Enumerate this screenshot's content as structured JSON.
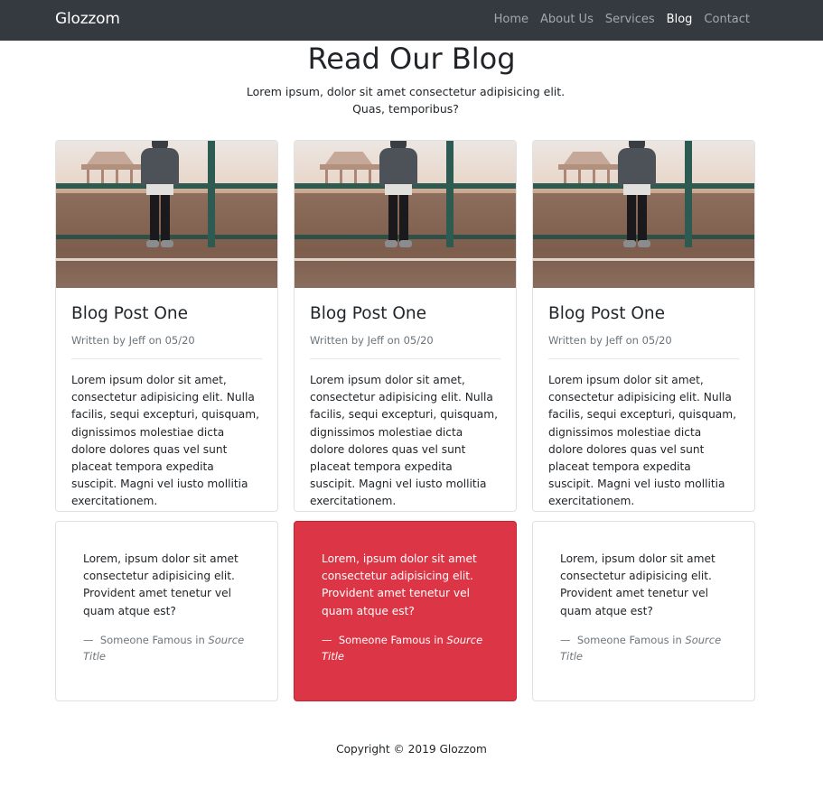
{
  "navbar": {
    "brand": "Glozzom",
    "links": [
      {
        "label": "Home",
        "active": false
      },
      {
        "label": "About Us",
        "active": false
      },
      {
        "label": "Services",
        "active": false
      },
      {
        "label": "Blog",
        "active": true
      },
      {
        "label": "Contact",
        "active": false
      }
    ]
  },
  "header": {
    "title": "Read Our Blog",
    "lead": "Lorem ipsum, dolor sit amet consectetur adipisicing elit. Quas, temporibus?"
  },
  "blog_posts": [
    {
      "title": "Blog Post One",
      "meta": "Written by Jeff on 05/20",
      "text": "Lorem ipsum dolor sit amet, consectetur adipisicing elit. Nulla facilis, sequi excepturi, quisquam, dignissimos molestiae dicta dolore dolores quas vel sunt placeat tempora expedita suscipit. Magni vel iusto mollitia exercitationem."
    },
    {
      "title": "Blog Post One",
      "meta": "Written by Jeff on 05/20",
      "text": "Lorem ipsum dolor sit amet, consectetur adipisicing elit. Nulla facilis, sequi excepturi, quisquam, dignissimos molestiae dicta dolore dolores quas vel sunt placeat tempora expedita suscipit. Magni vel iusto mollitia exercitationem."
    },
    {
      "title": "Blog Post One",
      "meta": "Written by Jeff on 05/20",
      "text": "Lorem ipsum dolor sit amet, consectetur adipisicing elit. Nulla facilis, sequi excepturi, quisquam, dignissimos molestiae dicta dolore dolores quas vel sunt placeat tempora expedita suscipit. Magni vel iusto mollitia exercitationem."
    }
  ],
  "quotes": [
    {
      "text": "Lorem, ipsum dolor sit amet consectetur adipisicing elit. Provident amet tenetur vel quam atque est?",
      "dash": "—",
      "author": "Someone Famous in",
      "source": "Source Title",
      "featured": false
    },
    {
      "text": "Lorem, ipsum dolor sit amet consectetur adipisicing elit. Provident amet tenetur vel quam atque est?",
      "dash": "—",
      "author": "Someone Famous in",
      "source": "Source Title",
      "featured": true
    },
    {
      "text": "Lorem, ipsum dolor sit amet consectetur adipisicing elit. Provident amet tenetur vel quam atque est?",
      "dash": "—",
      "author": "Someone Famous in",
      "source": "Source Title",
      "featured": false
    }
  ],
  "footer": {
    "copyright": "Copyright © 2019 Glozzom"
  },
  "colors": {
    "navbar_bg": "#343a40",
    "featured_quote_bg": "#dc3545",
    "muted_text": "#6c757d"
  }
}
